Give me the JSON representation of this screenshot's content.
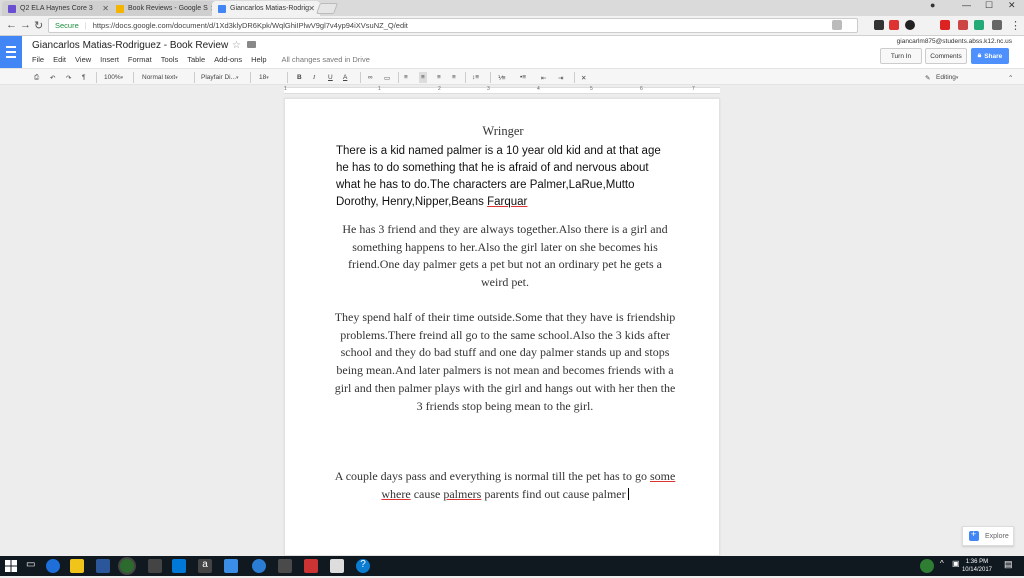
{
  "browser": {
    "tabs": [
      {
        "title": "Q2 ELA Haynes Core 3",
        "active": false,
        "color": "#6a4fd3"
      },
      {
        "title": "Book Reviews - Google S",
        "active": false,
        "color": "#f4b400"
      },
      {
        "title": "Giancarlos Matias-Rodrig",
        "active": true,
        "color": "#4285f4"
      }
    ],
    "secure_label": "Secure",
    "url": "https://docs.google.com/document/d/1Xd3klyDR6Kpk/WqlGhiIPlwV9gl7v4yp94iXVsuNZ_Q/edit"
  },
  "doc": {
    "title": "Giancarlos Matias-Rodriguez - Book Review",
    "menu": [
      "File",
      "Edit",
      "View",
      "Insert",
      "Format",
      "Tools",
      "Table",
      "Add-ons",
      "Help"
    ],
    "saved_status": "All changes saved in Drive",
    "user_email": "giancarlm875@students.abss.k12.nc.us",
    "turn_in": "Turn In",
    "comments": "Comments",
    "share": "Share"
  },
  "toolbar": {
    "zoom": "100%",
    "style": "Normal text",
    "font": "Playfair Di...",
    "size": "18",
    "bold": "B",
    "italic": "I",
    "underline": "U",
    "text_color": "A",
    "mode": "Editing"
  },
  "ruler": [
    "1",
    "1",
    "2",
    "3",
    "4",
    "5",
    "6",
    "7"
  ],
  "content": {
    "heading": "Wringer",
    "intro": "There is a kid named palmer is a 10 year old kid and at that age he has to do something that he is afraid of and nervous about what he has to do.The characters are Palmer,LaRue,Mutto Dorothy, Henry,Nipper,Beans",
    "intro_tail": "Farquar",
    "para1": "He has 3 friend and they are always together.Also there is a girl and something happens to her.Also the girl later on she becomes his friend.One day palmer gets a pet but not an ordinary pet he gets a weird pet.",
    "para2": "They spend half of their time outside.Some that they have is friendship problems.There freind all go to the same school.Also the 3 kids after school and they do bad stuff and one day palmer stands up and stops being mean.And later palmers is not mean and becomes friends with a girl and then palmer plays with the girl and hangs out with her then the 3 friends stop being mean to the girl.",
    "para3_a": "A couple days pass and everything is normal till the pet has to go",
    "para3_b": "some where",
    "para3_c": "cause",
    "para3_d": "palmers",
    "para3_e": "parents find out cause palmer"
  },
  "explore_label": "Explore",
  "clock": {
    "time": "1:36 PM",
    "date": "10/14/2017"
  }
}
